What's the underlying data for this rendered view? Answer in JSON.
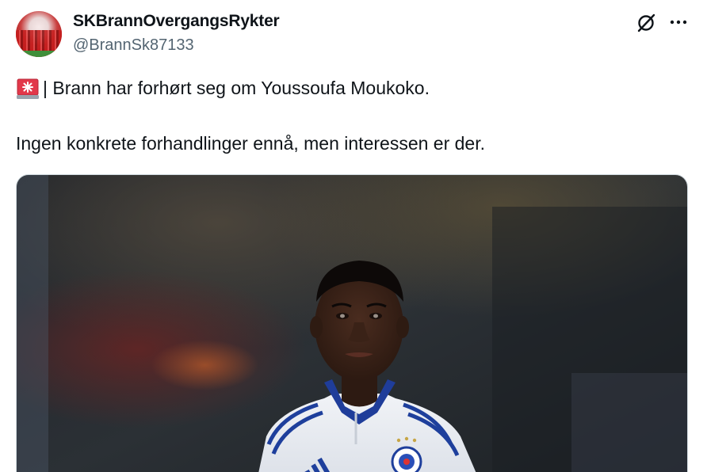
{
  "tweet": {
    "display_name": "SKBrannOvergangsRykter",
    "handle": "@BrannSk87133",
    "text_line1": "| Brann har forhørt seg om Youssoufa Moukoko.",
    "text_line2": "Ingen konkrete forhandlinger ennå, men interessen er der.",
    "leading_emoji": "police-car-light-emoji"
  },
  "header_actions": {
    "grok_icon": "grok-icon",
    "more_icon": "more-horizontal-icon"
  },
  "media": {
    "kind": "photo",
    "description_icon": "football-player-photo"
  },
  "colors": {
    "text_primary": "#0f1419",
    "text_secondary": "#536471",
    "border": "#cfd9de"
  }
}
